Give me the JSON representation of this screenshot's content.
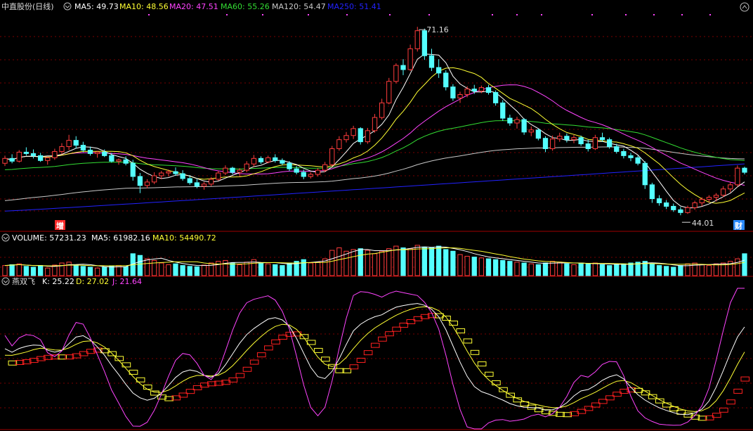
{
  "colors": {
    "up": "#ff3c3c",
    "down": "#54ffff",
    "grid": "#7a0000",
    "divider": "#a00000",
    "ma5": "#ffffff",
    "ma10": "#ffff33",
    "ma20": "#ff44ff",
    "ma60": "#33dd33",
    "ma120": "#c8c8c8",
    "ma250": "#2222ff",
    "k": "#ffffff",
    "d": "#ffff33",
    "j": "#ff44ff"
  },
  "price_panel": {
    "title": "中直股份(日线)",
    "legend": [
      {
        "label": "MA5: 49.73",
        "color_key": "ma5"
      },
      {
        "label": "MA10: 48.56",
        "color_key": "ma10"
      },
      {
        "label": "MA20: 47.51",
        "color_key": "ma20"
      },
      {
        "label": "MA60: 55.26",
        "color_key": "ma60"
      },
      {
        "label": "MA120: 54.47",
        "color_key": "ma120"
      },
      {
        "label": "MA250: 51.41",
        "color_key": "ma250"
      }
    ],
    "high_label": "71.16",
    "low_label": "44.01",
    "badge_left": "增",
    "badge_right": "财"
  },
  "volume_panel": {
    "legend": [
      {
        "label": "VOLUME: 57231.23",
        "color_key": "ma5"
      },
      {
        "label": "MA5: 61982.16",
        "color_key": "ma5"
      },
      {
        "label": "MA10: 54490.72",
        "color_key": "ma10"
      }
    ]
  },
  "indicator_panel": {
    "name": "燕双飞",
    "legend": [
      {
        "label": "K: 25.22",
        "color_key": "k"
      },
      {
        "label": "D: 27.02",
        "color_key": "d"
      },
      {
        "label": "J: 21.64",
        "color_key": "j"
      }
    ]
  },
  "chart_data": {
    "type": "candlestick",
    "title": "中直股份(日线)",
    "ylim": [
      42,
      73
    ],
    "y_high": 71.16,
    "y_low": 44.01,
    "ohlc": [
      [
        51.5,
        52.6,
        51.1,
        52.2
      ],
      [
        52.2,
        52.8,
        51.5,
        51.8
      ],
      [
        51.8,
        53.4,
        51.6,
        53.1
      ],
      [
        53.1,
        53.8,
        52.6,
        52.9
      ],
      [
        52.9,
        53.5,
        52.2,
        52.6
      ],
      [
        52.6,
        53.0,
        51.7,
        51.9
      ],
      [
        51.9,
        52.4,
        51.3,
        52.3
      ],
      [
        52.3,
        53.6,
        52.0,
        53.2
      ],
      [
        53.2,
        54.4,
        52.8,
        53.9
      ],
      [
        53.9,
        55.6,
        53.4,
        54.8
      ],
      [
        54.8,
        55.4,
        53.6,
        54.1
      ],
      [
        54.1,
        54.6,
        53.1,
        53.4
      ],
      [
        53.4,
        53.9,
        52.6,
        52.9
      ],
      [
        52.9,
        53.3,
        52.3,
        53.1
      ],
      [
        53.1,
        53.5,
        52.4,
        52.6
      ],
      [
        52.6,
        53.0,
        51.6,
        51.8
      ],
      [
        51.8,
        52.2,
        51.3,
        52.0
      ],
      [
        52.0,
        52.5,
        51.2,
        51.5
      ],
      [
        51.5,
        52.0,
        49.0,
        49.6
      ],
      [
        49.6,
        50.1,
        47.2,
        48.3
      ],
      [
        48.3,
        49.2,
        47.9,
        48.8
      ],
      [
        48.8,
        50.2,
        48.5,
        49.7
      ],
      [
        49.7,
        50.4,
        49.2,
        50.1
      ],
      [
        50.1,
        50.6,
        49.6,
        50.3
      ],
      [
        50.3,
        50.9,
        49.7,
        50.0
      ],
      [
        50.0,
        50.5,
        49.0,
        49.3
      ],
      [
        49.3,
        49.8,
        48.4,
        48.7
      ],
      [
        48.7,
        49.2,
        47.9,
        48.2
      ],
      [
        48.2,
        48.8,
        47.7,
        48.5
      ],
      [
        48.5,
        49.5,
        48.2,
        49.2
      ],
      [
        49.2,
        50.4,
        49.0,
        50.1
      ],
      [
        50.1,
        51.2,
        49.8,
        50.8
      ],
      [
        50.8,
        51.0,
        49.9,
        50.2
      ],
      [
        50.2,
        50.8,
        49.6,
        50.5
      ],
      [
        50.5,
        51.8,
        50.2,
        51.4
      ],
      [
        51.4,
        52.7,
        51.0,
        52.2
      ],
      [
        52.2,
        52.5,
        51.4,
        51.7
      ],
      [
        51.7,
        52.6,
        51.5,
        52.3
      ],
      [
        52.3,
        52.8,
        51.6,
        51.9
      ],
      [
        51.9,
        52.2,
        51.2,
        51.5
      ],
      [
        51.5,
        51.8,
        50.4,
        50.7
      ],
      [
        50.7,
        51.1,
        49.9,
        50.2
      ],
      [
        50.2,
        50.6,
        49.2,
        49.6
      ],
      [
        49.6,
        50.2,
        49.3,
        49.9
      ],
      [
        49.9,
        50.8,
        49.6,
        50.5
      ],
      [
        50.5,
        51.7,
        50.2,
        51.3
      ],
      [
        51.3,
        54.0,
        51.0,
        53.6
      ],
      [
        53.6,
        55.4,
        53.3,
        54.9
      ],
      [
        54.9,
        56.0,
        54.5,
        55.5
      ],
      [
        55.5,
        56.9,
        55.0,
        56.5
      ],
      [
        56.5,
        56.7,
        54.2,
        54.6
      ],
      [
        54.6,
        56.6,
        54.3,
        56.2
      ],
      [
        56.2,
        58.6,
        55.9,
        58.1
      ],
      [
        58.1,
        60.8,
        57.8,
        60.2
      ],
      [
        60.2,
        63.8,
        60.0,
        63.3
      ],
      [
        63.3,
        65.9,
        63.0,
        65.6
      ],
      [
        65.6,
        66.5,
        64.2,
        65.0
      ],
      [
        65.0,
        68.6,
        64.8,
        68.0
      ],
      [
        68.0,
        71.16,
        67.6,
        70.6
      ],
      [
        70.6,
        70.9,
        66.4,
        67.0
      ],
      [
        67.0,
        68.0,
        64.8,
        65.3
      ],
      [
        65.3,
        66.5,
        63.8,
        64.5
      ],
      [
        64.5,
        64.9,
        62.0,
        62.5
      ],
      [
        62.5,
        62.9,
        60.5,
        60.9
      ],
      [
        60.9,
        61.8,
        60.2,
        61.4
      ],
      [
        61.4,
        62.6,
        61.0,
        62.2
      ],
      [
        62.2,
        62.8,
        61.5,
        61.9
      ],
      [
        61.9,
        62.7,
        61.6,
        62.4
      ],
      [
        62.4,
        62.8,
        61.4,
        61.7
      ],
      [
        61.7,
        62.0,
        59.8,
        60.2
      ],
      [
        60.2,
        60.6,
        57.6,
        58.0
      ],
      [
        58.0,
        58.5,
        56.9,
        57.3
      ],
      [
        57.3,
        58.2,
        56.5,
        57.8
      ],
      [
        57.8,
        58.0,
        55.6,
        56.0
      ],
      [
        56.0,
        56.8,
        55.4,
        56.3
      ],
      [
        56.3,
        56.5,
        54.8,
        55.1
      ],
      [
        55.1,
        55.4,
        53.1,
        53.6
      ],
      [
        53.6,
        55.5,
        53.3,
        55.0
      ],
      [
        55.0,
        55.9,
        54.6,
        55.4
      ],
      [
        55.4,
        55.8,
        54.5,
        54.9
      ],
      [
        54.9,
        55.6,
        54.4,
        55.2
      ],
      [
        55.2,
        55.5,
        54.0,
        54.3
      ],
      [
        54.3,
        54.9,
        53.2,
        53.6
      ],
      [
        53.6,
        55.6,
        53.4,
        55.2
      ],
      [
        55.2,
        55.9,
        54.6,
        54.9
      ],
      [
        54.9,
        55.2,
        53.6,
        53.9
      ],
      [
        53.9,
        54.3,
        52.9,
        53.2
      ],
      [
        53.2,
        53.6,
        52.2,
        52.6
      ],
      [
        52.6,
        53.0,
        51.8,
        52.3
      ],
      [
        52.3,
        52.6,
        51.2,
        51.5
      ],
      [
        51.5,
        51.8,
        47.8,
        48.4
      ],
      [
        48.4,
        48.7,
        45.8,
        46.4
      ],
      [
        46.4,
        46.9,
        45.4,
        45.8
      ],
      [
        45.8,
        46.2,
        44.9,
        45.3
      ],
      [
        45.3,
        45.7,
        44.5,
        44.8
      ],
      [
        44.8,
        45.2,
        44.01,
        44.4
      ],
      [
        44.4,
        45.4,
        44.2,
        45.1
      ],
      [
        45.1,
        46.1,
        44.8,
        45.8
      ],
      [
        45.8,
        46.6,
        45.3,
        46.3
      ],
      [
        46.3,
        46.9,
        45.9,
        46.6
      ],
      [
        46.6,
        47.2,
        46.0,
        46.9
      ],
      [
        46.9,
        48.2,
        46.6,
        47.8
      ],
      [
        47.8,
        48.8,
        47.3,
        48.4
      ],
      [
        48.4,
        51.2,
        48.1,
        50.8
      ],
      [
        50.8,
        51.0,
        49.9,
        50.2
      ]
    ],
    "volume": [
      24,
      26,
      28,
      22,
      20,
      24,
      18,
      25,
      30,
      32,
      26,
      22,
      20,
      18,
      20,
      22,
      24,
      21,
      52,
      48,
      40,
      36,
      30,
      26,
      28,
      24,
      22,
      21,
      25,
      30,
      34,
      36,
      30,
      26,
      32,
      38,
      30,
      28,
      26,
      24,
      30,
      34,
      38,
      30,
      32,
      40,
      60,
      66,
      58,
      62,
      64,
      60,
      52,
      58,
      64,
      70,
      66,
      64,
      72,
      68,
      66,
      70,
      62,
      58,
      50,
      46,
      44,
      42,
      40,
      38,
      36,
      34,
      32,
      30,
      28,
      26,
      30,
      34,
      32,
      28,
      26,
      30,
      28,
      30,
      26,
      24,
      26,
      28,
      30,
      32,
      34,
      28,
      24,
      22,
      20,
      24,
      28,
      30,
      26,
      24,
      28,
      30,
      34,
      40,
      52
    ],
    "volume_ma5": 61982.16,
    "volume_ma10": 54490.72,
    "ma_lines": {
      "MA5": 49.73,
      "MA10": 48.56,
      "MA20": 47.51,
      "MA60": 55.26,
      "MA120": 54.47,
      "MA250": 51.41
    },
    "kdj_last": {
      "K": 25.22,
      "D": 27.02,
      "J": 21.64
    },
    "kdj_yrange": [
      -5,
      105
    ]
  }
}
